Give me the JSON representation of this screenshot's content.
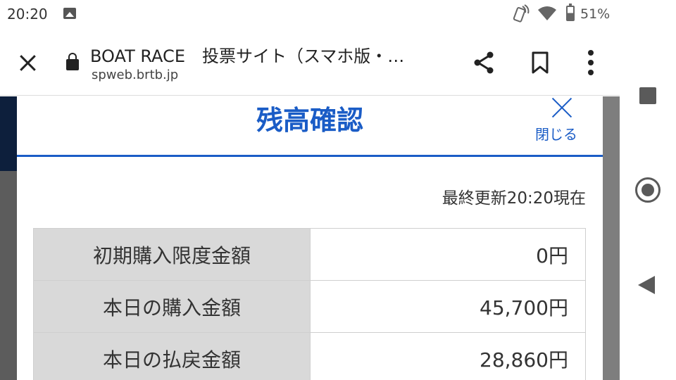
{
  "status_bar": {
    "time": "20:20",
    "battery": "51%",
    "icons": [
      "image-icon",
      "nfc-icon",
      "wifi-icon",
      "battery-icon"
    ]
  },
  "browser": {
    "title": "BOAT RACE　投票サイト（スマホ版・…",
    "url": "spweb.brtb.jp",
    "icons": [
      "close-icon",
      "lock-icon",
      "share-icon",
      "bookmark-icon",
      "more-vert-icon"
    ]
  },
  "modal": {
    "title": "残高確認",
    "close_label": "閉じる",
    "updated": "最終更新20:20現在",
    "rows": [
      {
        "label": "初期購入限度金額",
        "value": "0円"
      },
      {
        "label": "本日の購入金額",
        "value": "45,700円"
      },
      {
        "label": "本日の払戻金額",
        "value": "28,860円"
      }
    ]
  },
  "colors": {
    "accent": "#1a5cc6",
    "label_bg": "#d9d9d9",
    "overlay": "#7e7e7e"
  },
  "navigation": {
    "icons": [
      "recents-icon",
      "home-icon",
      "back-icon"
    ]
  }
}
